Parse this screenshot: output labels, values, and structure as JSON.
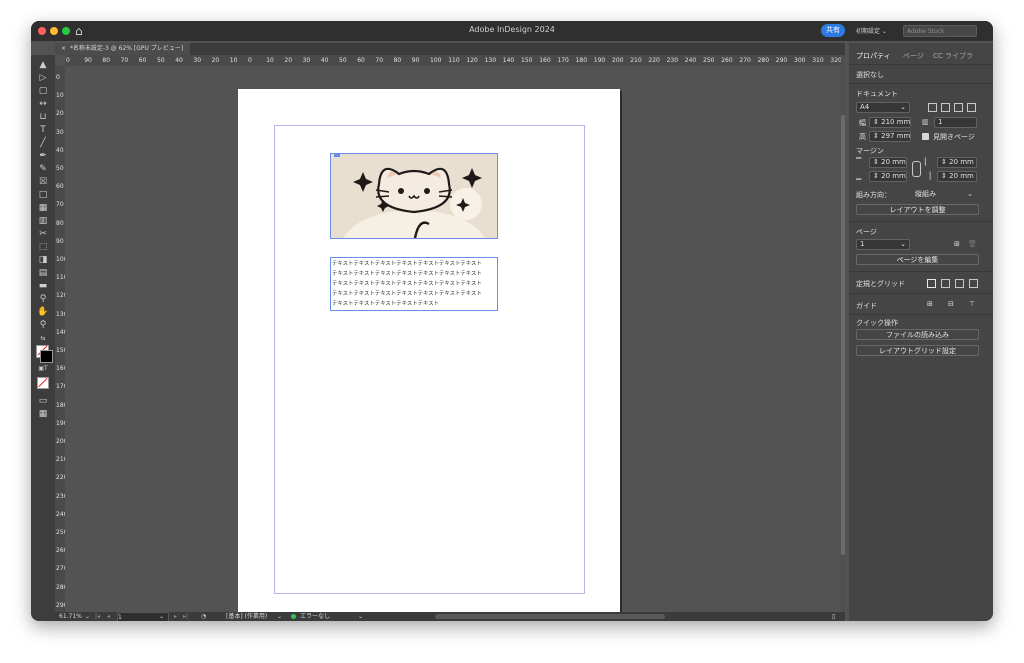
{
  "window": {
    "title": "Adobe InDesign 2024"
  },
  "titlebar": {
    "share_label": "共有",
    "workspace_label": "初期設定 ⌄",
    "stock_placeholder": "Adobe Stock"
  },
  "colors": {
    "close": "#ff5f57",
    "minimize": "#febc2e",
    "maximize": "#28c840",
    "accent": "#2d7ae5",
    "frame": "#6a8ee8",
    "margin_guide": "#b8b3e8"
  },
  "document_tab": {
    "label": "*名称未設定-3 @ 62% [GPU プレビュー]"
  },
  "ruler": {
    "h_ticks": [
      "0",
      "90",
      "80",
      "70",
      "60",
      "50",
      "40",
      "30",
      "20",
      "10",
      "0",
      "10",
      "20",
      "30",
      "40",
      "50",
      "60",
      "70",
      "80",
      "90",
      "100",
      "110",
      "120",
      "130",
      "140",
      "150",
      "160",
      "170",
      "180",
      "190",
      "200",
      "210",
      "220",
      "230",
      "240",
      "250",
      "260",
      "270",
      "280",
      "290",
      "300",
      "310",
      "320"
    ]
  },
  "tools": [
    "selection-tool",
    "direct-selection-tool",
    "page-tool",
    "gap-tool",
    "content-collector-tool",
    "type-tool",
    "line-tool",
    "pen-tool",
    "pencil-tool",
    "rectangle-frame-tool",
    "rectangle-tool",
    "table-tool",
    "grid-tool",
    "scissors-tool",
    "free-transform-tool",
    "gradient-swatch-tool",
    "gradient-feather-tool",
    "note-tool",
    "eyedropper-tool",
    "hand-tool",
    "zoom-tool",
    "swap-colors",
    "fill-stroke",
    "container-text",
    "apply-none",
    "screen-mode",
    "page-view"
  ],
  "canvas": {
    "text_lines": [
      "テキストテキストテキストテキストテキストテキストテキスト",
      "テキストテキストテキストテキストテキストテキストテキスト",
      "テキストテキストテキストテキストテキストテキストテキスト",
      "テキストテキストテキストテキストテキストテキストテキスト",
      "テキストテキストテキストテキストテキスト"
    ]
  },
  "statusbar": {
    "zoom": "61.71%",
    "page": "1",
    "style": "[基本] (作業用)",
    "preflight": "エラーなし"
  },
  "panel": {
    "tabs": [
      "プロパティ",
      "ページ",
      "CC ライブラ"
    ],
    "selection": "選択なし",
    "document_heading": "ドキュメント",
    "page_size": "A4",
    "width_label": "幅",
    "width_value": "210 mm",
    "height_label": "高",
    "height_value": "297 mm",
    "pages_value": "1",
    "facing_pages": "見開きページ",
    "margin_heading": "マージン",
    "margin_top": "20 mm",
    "margin_bottom": "20 mm",
    "margin_inside": "20 mm",
    "margin_outside": "20 mm",
    "direction_label": "組み方向：",
    "direction_value": "縦組み",
    "adjust_layout": "レイアウトを調整",
    "page_heading": "ページ",
    "page_value": "1",
    "edit_page": "ページを編集",
    "rulers_grids": "定規とグリッド",
    "guides": "ガイド",
    "quick_actions": "クイック操作",
    "import_file": "ファイルの読み込み",
    "layout_grid": "レイアウトグリッド設定"
  }
}
